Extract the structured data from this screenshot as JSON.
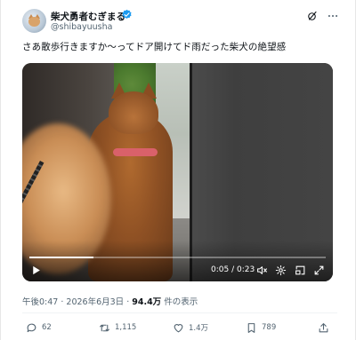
{
  "user": {
    "display_name": "柴犬勇者むぎまる",
    "handle": "@shibayuusha"
  },
  "tweet": {
    "text": "さあ散歩行きますか〜ってドア開けてド雨だった柴犬の絶望感"
  },
  "video": {
    "time_display": "0:05 / 0:23",
    "progress_fraction": 0.217
  },
  "meta": {
    "time": "午後0:47",
    "date": "2026年6月3日",
    "separator": " · ",
    "views": "94.4万",
    "views_suffix": " 件の表示"
  },
  "actions": {
    "replies": "62",
    "retweets": "1,115",
    "likes": "1.4万",
    "bookmarks": "789"
  },
  "colors": {
    "verified": "#1d9bf0",
    "secondary_text": "#536471"
  },
  "icons": [
    "verified-badge-icon",
    "grok-icon",
    "more-icon",
    "play-icon",
    "volume-icon",
    "settings-icon",
    "pip-icon",
    "fullscreen-icon",
    "reply-icon",
    "retweet-icon",
    "like-icon",
    "bookmark-icon",
    "share-icon"
  ]
}
